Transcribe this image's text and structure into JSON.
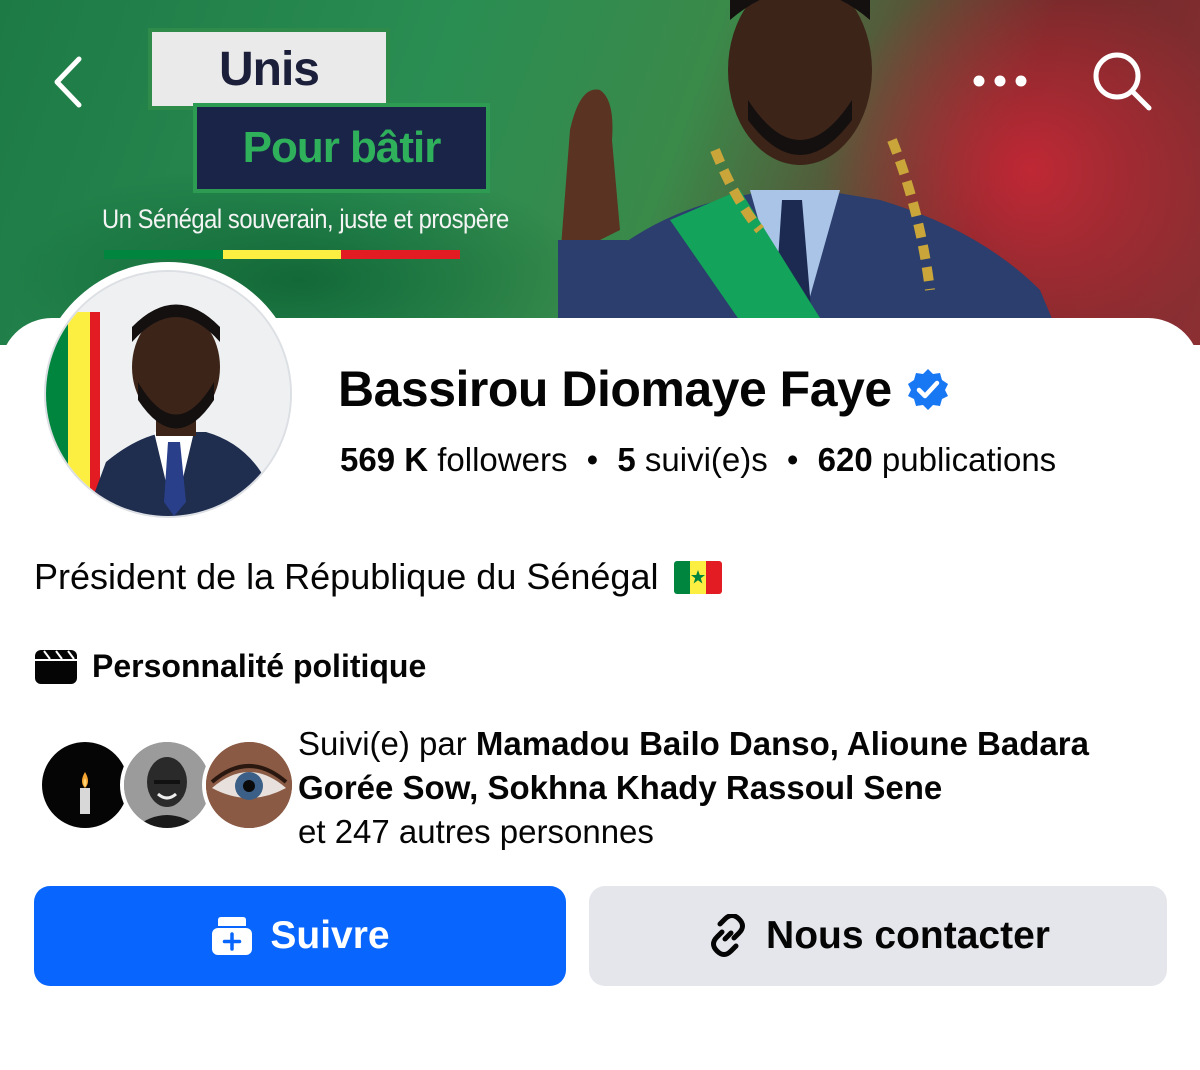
{
  "cover": {
    "headline_1": "Unis",
    "headline_2": "Pour bâtir",
    "slogan": "Un Sénégal souverain, juste et prospère",
    "flag_colors": [
      "#00853f",
      "#fdef42",
      "#e31b23"
    ]
  },
  "nav": {
    "back_icon": "chevron-left-icon",
    "more_icon": "more-dots-icon",
    "search_icon": "search-icon"
  },
  "profile": {
    "name": "Bassirou Diomaye Faye",
    "verified": true,
    "verified_color": "#1877f2",
    "stats": {
      "followers_value": "569 K",
      "followers_label": "followers",
      "following_value": "5",
      "following_label": "suivi(e)s",
      "posts_value": "620",
      "posts_label": "publications",
      "separator": "•"
    },
    "bio": "Président de la République du Sénégal",
    "category": "Personnalité politique"
  },
  "mutuals": {
    "prefix": "Suivi(e) par",
    "names": "Mamadou Bailo Danso, Alioune Badara Gorée Sow, Sokhna Khady Rassoul Sene",
    "suffix": "et 247 autres personnes"
  },
  "actions": {
    "follow_label": "Suivre",
    "contact_label": "Nous contacter",
    "accent_color": "#0866ff"
  }
}
